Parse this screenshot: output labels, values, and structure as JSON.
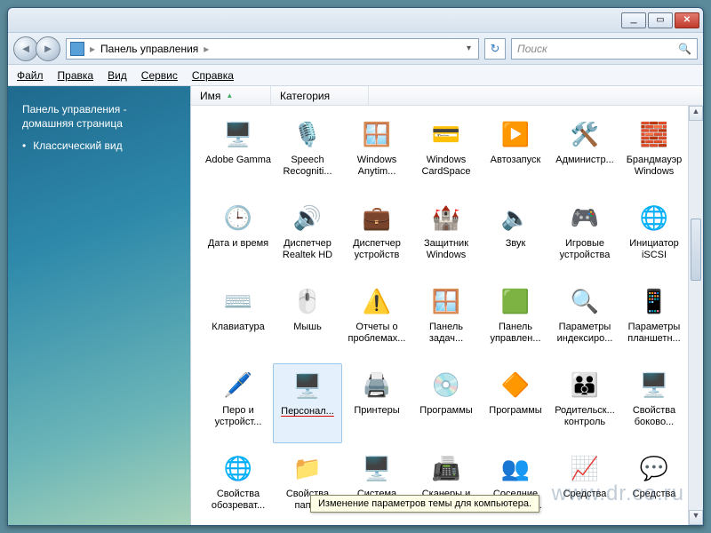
{
  "titlebar": {
    "min": "minimize",
    "max": "maximize",
    "close": "close"
  },
  "nav": {
    "breadcrumb_root": "Панель управления",
    "search_placeholder": "Поиск"
  },
  "menu": {
    "file": "Файл",
    "edit": "Правка",
    "view": "Вид",
    "tools": "Сервис",
    "help": "Справка"
  },
  "sidebar": {
    "home_line1": "Панель управления -",
    "home_line2": "домашняя страница",
    "classic": "Классический вид"
  },
  "columns": {
    "name": "Имя",
    "category": "Категория"
  },
  "tooltip": "Изменение параметров темы для компьютера.",
  "watermark": "www.dr.co.ru",
  "items": [
    {
      "label": "Adobe Gamma",
      "icon": "monitor-blue"
    },
    {
      "label": "Speech Recogniti...",
      "icon": "microphone"
    },
    {
      "label": "Windows Anytim...",
      "icon": "windows-flag"
    },
    {
      "label": "Windows CardSpace",
      "icon": "cardspace"
    },
    {
      "label": "Автозапуск",
      "icon": "autoplay"
    },
    {
      "label": "Администр...",
      "icon": "admin-tools"
    },
    {
      "label": "Брандмауэр Windows",
      "icon": "firewall"
    },
    {
      "label": "Дата и время",
      "icon": "clock-calendar"
    },
    {
      "label": "Диспетчер Realtek HD",
      "icon": "audio-chip"
    },
    {
      "label": "Диспетчер устройств",
      "icon": "device-manager"
    },
    {
      "label": "Защитник Windows",
      "icon": "defender"
    },
    {
      "label": "Звук",
      "icon": "speaker"
    },
    {
      "label": "Игровые устройства",
      "icon": "gamepad"
    },
    {
      "label": "Инициатор iSCSI",
      "icon": "iscsi"
    },
    {
      "label": "Клавиатура",
      "icon": "keyboard"
    },
    {
      "label": "Мышь",
      "icon": "mouse"
    },
    {
      "label": "Отчеты о проблемах...",
      "icon": "problem-report"
    },
    {
      "label": "Панель задач...",
      "icon": "taskbar"
    },
    {
      "label": "Панель управлен...",
      "icon": "nvidia"
    },
    {
      "label": "Параметры индексиро...",
      "icon": "indexing"
    },
    {
      "label": "Параметры планшетн...",
      "icon": "tablet"
    },
    {
      "label": "Перо и устройст...",
      "icon": "pen"
    },
    {
      "label": "Персонал...",
      "icon": "personalization",
      "selected": true
    },
    {
      "label": "Принтеры",
      "icon": "printer"
    },
    {
      "label": "Программы",
      "icon": "programs-disc"
    },
    {
      "label": "Программы",
      "icon": "programs-default"
    },
    {
      "label": "Родительск... контроль",
      "icon": "parental"
    },
    {
      "label": "Свойства боково...",
      "icon": "sidebar-props"
    },
    {
      "label": "Свойства обозреват...",
      "icon": "internet-options"
    },
    {
      "label": "Свойства папки",
      "icon": "folder-options"
    },
    {
      "label": "Система",
      "icon": "system"
    },
    {
      "label": "Сканеры и камеры",
      "icon": "scanner"
    },
    {
      "label": "Соседние пользоват...",
      "icon": "people-near"
    },
    {
      "label": "Средства",
      "icon": "tools-green"
    },
    {
      "label": "Средства",
      "icon": "text-speech"
    }
  ]
}
